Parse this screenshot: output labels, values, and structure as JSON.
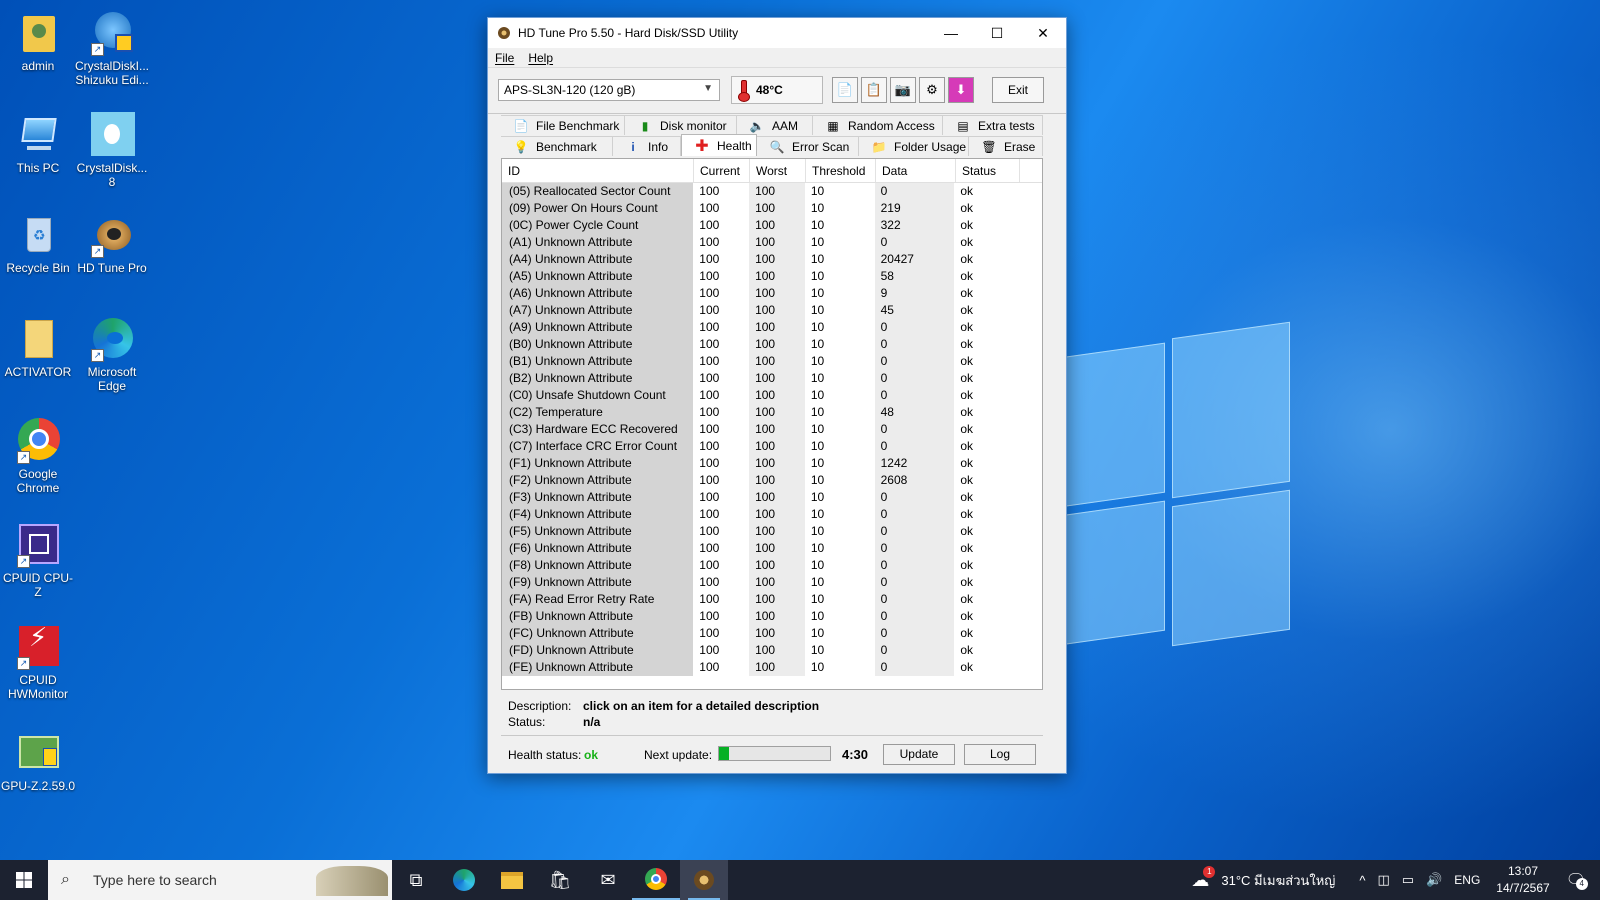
{
  "desktop": {
    "icons": [
      {
        "label": "admin"
      },
      {
        "label": "CrystalDiskI... Shizuku Edi..."
      },
      {
        "label": "This PC"
      },
      {
        "label": "CrystalDisk... 8"
      },
      {
        "label": "Recycle Bin"
      },
      {
        "label": "HD Tune Pro"
      },
      {
        "label": "ACTIVATOR"
      },
      {
        "label": "Microsoft Edge"
      },
      {
        "label": "Google Chrome"
      },
      {
        "label": "CPUID CPU-Z"
      },
      {
        "label": "CPUID HWMonitor"
      },
      {
        "label": "GPU-Z.2.59.0"
      }
    ]
  },
  "window": {
    "title": "HD Tune Pro 5.50 - Hard Disk/SSD Utility",
    "menu": [
      "File",
      "Help"
    ],
    "drive": "APS-SL3N-120 (120 gB)",
    "temperature": "48°C",
    "exit_label": "Exit",
    "tabs_row1": [
      "File Benchmark",
      "Disk monitor",
      "AAM",
      "Random Access",
      "Extra tests"
    ],
    "tabs_row2": [
      "Benchmark",
      "Info",
      "Health",
      "Error Scan",
      "Folder Usage",
      "Erase"
    ],
    "active_tab": "Health",
    "columns": [
      "ID",
      "Current",
      "Worst",
      "Threshold",
      "Data",
      "Status"
    ],
    "rows": [
      [
        "(05) Reallocated Sector Count",
        "100",
        "100",
        "10",
        "0",
        "ok"
      ],
      [
        "(09) Power On Hours Count",
        "100",
        "100",
        "10",
        "219",
        "ok"
      ],
      [
        "(0C) Power Cycle Count",
        "100",
        "100",
        "10",
        "322",
        "ok"
      ],
      [
        "(A1) Unknown Attribute",
        "100",
        "100",
        "10",
        "0",
        "ok"
      ],
      [
        "(A4) Unknown Attribute",
        "100",
        "100",
        "10",
        "20427",
        "ok"
      ],
      [
        "(A5) Unknown Attribute",
        "100",
        "100",
        "10",
        "58",
        "ok"
      ],
      [
        "(A6) Unknown Attribute",
        "100",
        "100",
        "10",
        "9",
        "ok"
      ],
      [
        "(A7) Unknown Attribute",
        "100",
        "100",
        "10",
        "45",
        "ok"
      ],
      [
        "(A9) Unknown Attribute",
        "100",
        "100",
        "10",
        "0",
        "ok"
      ],
      [
        "(B0) Unknown Attribute",
        "100",
        "100",
        "10",
        "0",
        "ok"
      ],
      [
        "(B1) Unknown Attribute",
        "100",
        "100",
        "10",
        "0",
        "ok"
      ],
      [
        "(B2) Unknown Attribute",
        "100",
        "100",
        "10",
        "0",
        "ok"
      ],
      [
        "(C0) Unsafe Shutdown Count",
        "100",
        "100",
        "10",
        "0",
        "ok"
      ],
      [
        "(C2) Temperature",
        "100",
        "100",
        "10",
        "48",
        "ok"
      ],
      [
        "(C3) Hardware ECC Recovered",
        "100",
        "100",
        "10",
        "0",
        "ok"
      ],
      [
        "(C7) Interface CRC Error Count",
        "100",
        "100",
        "10",
        "0",
        "ok"
      ],
      [
        "(F1) Unknown Attribute",
        "100",
        "100",
        "10",
        "1242",
        "ok"
      ],
      [
        "(F2) Unknown Attribute",
        "100",
        "100",
        "10",
        "2608",
        "ok"
      ],
      [
        "(F3) Unknown Attribute",
        "100",
        "100",
        "10",
        "0",
        "ok"
      ],
      [
        "(F4) Unknown Attribute",
        "100",
        "100",
        "10",
        "0",
        "ok"
      ],
      [
        "(F5) Unknown Attribute",
        "100",
        "100",
        "10",
        "0",
        "ok"
      ],
      [
        "(F6) Unknown Attribute",
        "100",
        "100",
        "10",
        "0",
        "ok"
      ],
      [
        "(F8) Unknown Attribute",
        "100",
        "100",
        "10",
        "0",
        "ok"
      ],
      [
        "(F9) Unknown Attribute",
        "100",
        "100",
        "10",
        "0",
        "ok"
      ],
      [
        "(FA) Read Error Retry Rate",
        "100",
        "100",
        "10",
        "0",
        "ok"
      ],
      [
        "(FB) Unknown Attribute",
        "100",
        "100",
        "10",
        "0",
        "ok"
      ],
      [
        "(FC) Unknown Attribute",
        "100",
        "100",
        "10",
        "0",
        "ok"
      ],
      [
        "(FD) Unknown Attribute",
        "100",
        "100",
        "10",
        "0",
        "ok"
      ],
      [
        "(FE) Unknown Attribute",
        "100",
        "100",
        "10",
        "0",
        "ok"
      ]
    ],
    "description_label": "Description:",
    "description_value": "click on an item for a detailed description",
    "status_label": "Status:",
    "status_value": "n/a",
    "health_status_label": "Health status:",
    "health_status_value": "ok",
    "next_update_label": "Next update:",
    "next_update_progress": 0.09,
    "next_update_time": "4:30",
    "update_label": "Update",
    "log_label": "Log"
  },
  "taskbar": {
    "search_placeholder": "Type here to search",
    "weather": "31°C มีเมฆส่วนใหญ่",
    "language": "ENG",
    "time": "13:07",
    "date": "14/7/2567",
    "notification_count": "4",
    "weather_badge": "1"
  },
  "colors": {
    "health_ok": "#17b117",
    "progress_fill": "#06b025",
    "taskbar": "#1c2230"
  }
}
